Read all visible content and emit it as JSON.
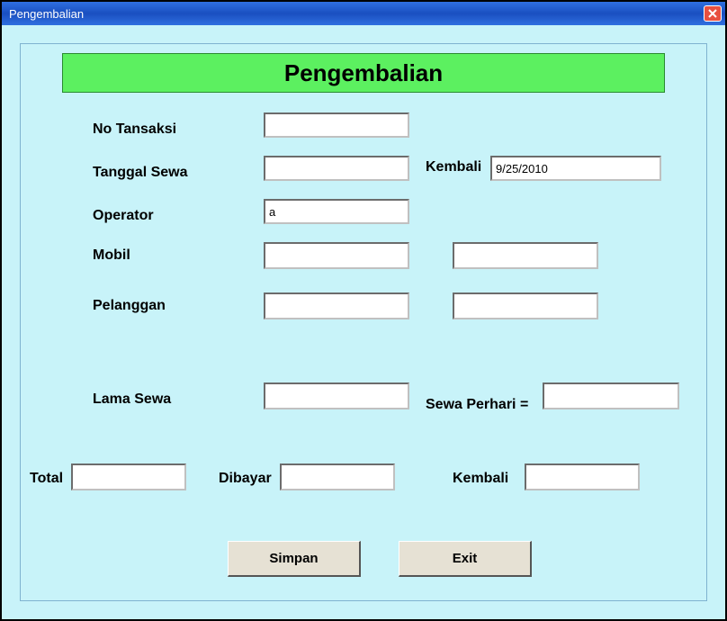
{
  "window": {
    "title": "Pengembalian"
  },
  "header": {
    "banner": "Pengembalian"
  },
  "labels": {
    "noTransaksi": "No Tansaksi",
    "tanggalSewa": "Tanggal Sewa",
    "kembaliDate": "Kembali",
    "operator": "Operator",
    "mobil": "Mobil",
    "pelanggan": "Pelanggan",
    "lamaSewa": "Lama Sewa",
    "sewaPerhariEq": "Sewa Perhari =",
    "total": "Total",
    "dibayar": "Dibayar",
    "kembaliTotal": "Kembali"
  },
  "values": {
    "noTransaksi": "",
    "tanggalSewa": "",
    "kembaliDate": "9/25/2010",
    "operator": "a",
    "mobil1": "",
    "mobil2": "",
    "pelanggan1": "",
    "pelanggan2": "",
    "lamaSewa": "",
    "sewaPerhari": "",
    "total": "",
    "dibayar": "",
    "kembaliTotal": ""
  },
  "buttons": {
    "simpan": "Simpan",
    "exit": "Exit"
  }
}
